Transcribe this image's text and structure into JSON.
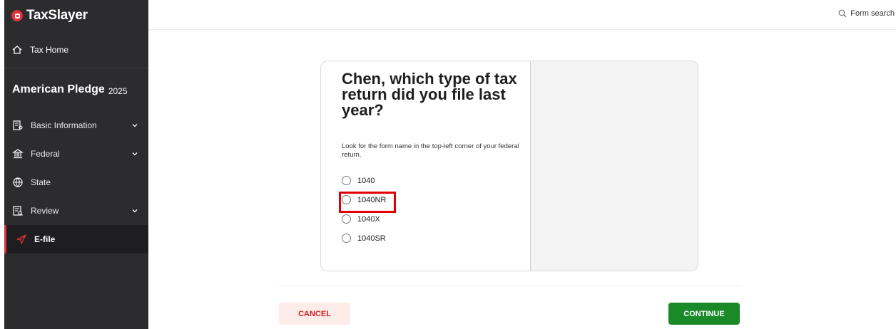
{
  "brand": {
    "name": "TaxSlayer",
    "icon": "taxslayer-logo-icon",
    "color": "#e0323c"
  },
  "topbar": {
    "search_label": "Form search",
    "search_icon": "search-icon"
  },
  "sidebar": {
    "home": {
      "label": "Tax Home",
      "icon": "home-icon"
    },
    "return_title": "American Pledge",
    "return_year": "2025",
    "items": [
      {
        "label": "Basic Information",
        "icon": "basic-info-icon",
        "expandable": true
      },
      {
        "label": "Federal",
        "icon": "federal-building-icon",
        "expandable": true
      },
      {
        "label": "State",
        "icon": "globe-icon",
        "expandable": false
      },
      {
        "label": "Review",
        "icon": "review-icon",
        "expandable": true
      },
      {
        "label": "E-file",
        "icon": "paper-plane-icon",
        "expandable": false,
        "active": true
      }
    ]
  },
  "main": {
    "question": "Chen, which type of tax return did you file last year?",
    "hint": "Look for the form name in the top-left corner of your federal return.",
    "options": [
      "1040",
      "1040NR",
      "1040X",
      "1040SR"
    ],
    "highlighted_option": "1040NR"
  },
  "footer": {
    "cancel_label": "CANCEL",
    "continue_label": "CONTINUE",
    "cancel_color": "#d0202a",
    "continue_color": "#1a8a28"
  }
}
